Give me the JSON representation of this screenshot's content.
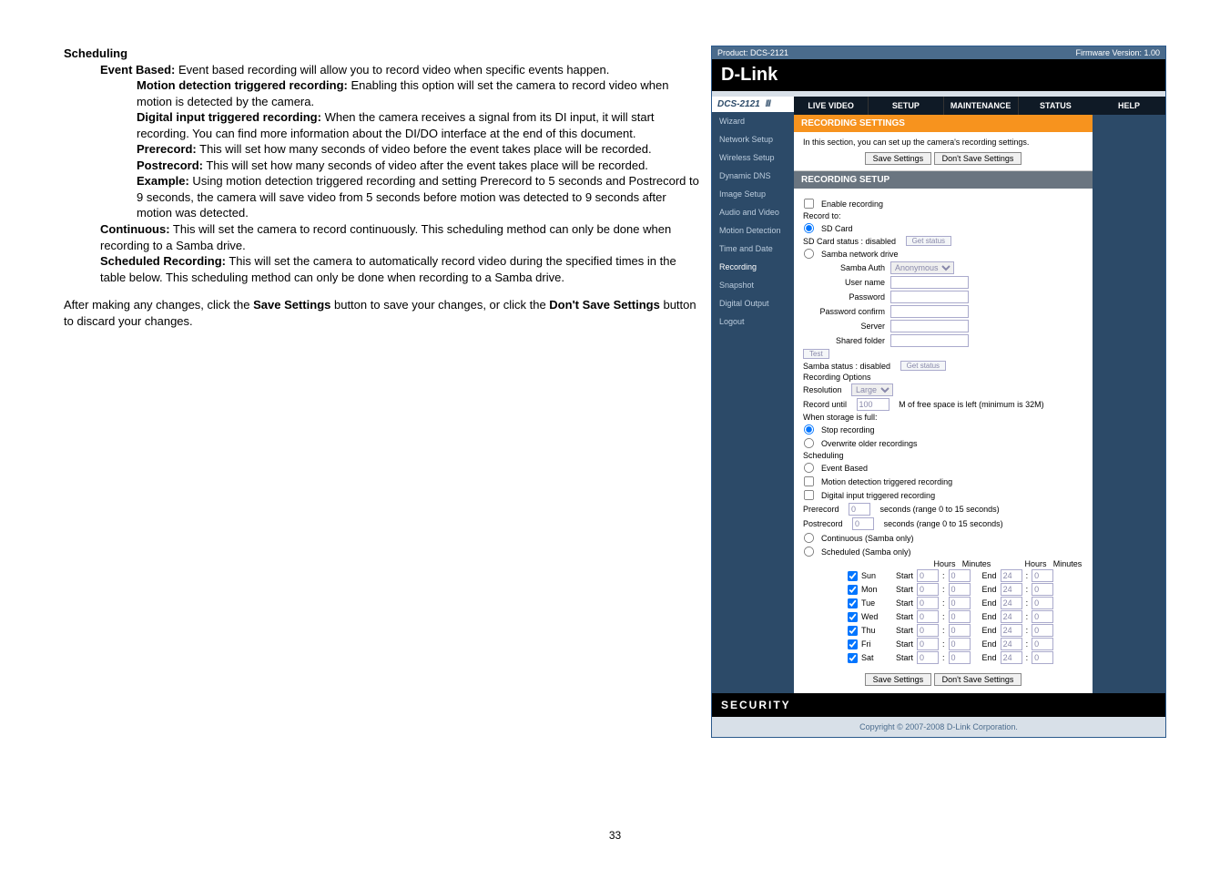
{
  "doc": {
    "heading": "Scheduling",
    "event_based_label": "Event Based:",
    "event_based_text": "  Event based recording will allow you to record video when specific events happen.",
    "motion_label": "Motion detection triggered recording:",
    "motion_text": "    Enabling this option will set the camera to record video when motion is detected by the camera.",
    "di_label": "Digital input triggered recording:",
    "di_text": "   When the camera receives a signal from its DI input, it will start recording. You can find more information about the DI/DO interface at the end of this document.",
    "prerecord_label": "Prerecord:",
    "prerecord_text": "  This will set how many seconds of video before the event takes place will be recorded.",
    "postrecord_label": "Postrecord:",
    "postrecord_text": "  This will set how many seconds of video after the event takes place will be recorded.",
    "example_label": "Example:",
    "example_text": " Using motion detection triggered recording and setting Prerecord to 5 seconds and Postrecord to 9 seconds, the camera will save video from 5 seconds before motion was detected to 9 seconds after motion was detected.",
    "continuous_label": "Continuous:",
    "continuous_text": "  This will set the camera to record continuously. This scheduling method can only be done when recording to a Samba drive.",
    "scheduled_label": "Scheduled Recording:",
    "scheduled_text": "  This will set the camera to automatically record video during the specified times in the table below. This scheduling method can only be done when recording to a Samba drive.",
    "para_after_1": "After making any changes, click the ",
    "para_after_bold1": "Save Settings",
    "para_after_2": " button to save your changes, or click the ",
    "para_after_bold2": "Don't Save Settings",
    "para_after_3": " button to discard your changes.",
    "page_number": "33"
  },
  "app": {
    "topbar": {
      "product": "Product: DCS-2121",
      "firmware": "Firmware Version: 1.00"
    },
    "logo": "D-Link",
    "model": "DCS-2121",
    "tabs": [
      "LIVE VIDEO",
      "SETUP",
      "MAINTENANCE",
      "STATUS",
      "HELP"
    ],
    "sidebar": [
      "Wizard",
      "Network Setup",
      "Wireless Setup",
      "Dynamic DNS",
      "Image Setup",
      "Audio and Video",
      "Motion Detection",
      "Time and Date",
      "Recording",
      "Snapshot",
      "Digital Output",
      "Logout"
    ],
    "section_title": "RECORDING SETTINGS",
    "section_desc": "In this section, you can set up the camera's recording settings.",
    "save_btn": "Save Settings",
    "dont_save_btn": "Don't Save Settings",
    "setup_title": "RECORDING SETUP",
    "enable_recording": "Enable recording",
    "record_to": "Record to:",
    "sd_card": "SD Card",
    "sd_status": "SD Card status : disabled",
    "get_status": "Get status",
    "samba_drive": "Samba network drive",
    "samba_auth": "Samba Auth",
    "samba_auth_val": "Anonymous",
    "user_name": "User name",
    "password": "Password",
    "password_confirm": "Password confirm",
    "server": "Server",
    "shared_folder": "Shared folder",
    "test": "Test",
    "samba_status": "Samba status : disabled",
    "rec_options": "Recording Options",
    "resolution": "Resolution",
    "resolution_val": "Large",
    "record_until": "Record until",
    "record_until_val": "100",
    "record_until_text": "M of free space is left (minimum is 32M)",
    "when_full": "When storage is full:",
    "stop_recording": "Stop recording",
    "overwrite": "Overwrite older recordings",
    "scheduling": "Scheduling",
    "event_based": "Event Based",
    "motion_triggered": "Motion detection triggered recording",
    "di_triggered": "Digital input triggered recording",
    "prerecord_lbl": "Prerecord",
    "prerecord_val": "0",
    "prerecord_hint": "seconds (range 0 to 15 seconds)",
    "postrecord_lbl": "Postrecord",
    "postrecord_val": "0",
    "postrecord_hint": "seconds (range 0 to 15 seconds)",
    "continuous": "Continuous (Samba only)",
    "scheduled": "Scheduled (Samba only)",
    "hours": "Hours",
    "minutes": "Minutes",
    "start": "Start",
    "end": "End",
    "days": [
      "Sun",
      "Mon",
      "Tue",
      "Wed",
      "Thu",
      "Fri",
      "Sat"
    ],
    "start_h": "0",
    "start_m": "0",
    "end_h": "24",
    "end_m": "0",
    "footer": "SECURITY",
    "copyright": "Copyright © 2007-2008 D-Link Corporation."
  }
}
